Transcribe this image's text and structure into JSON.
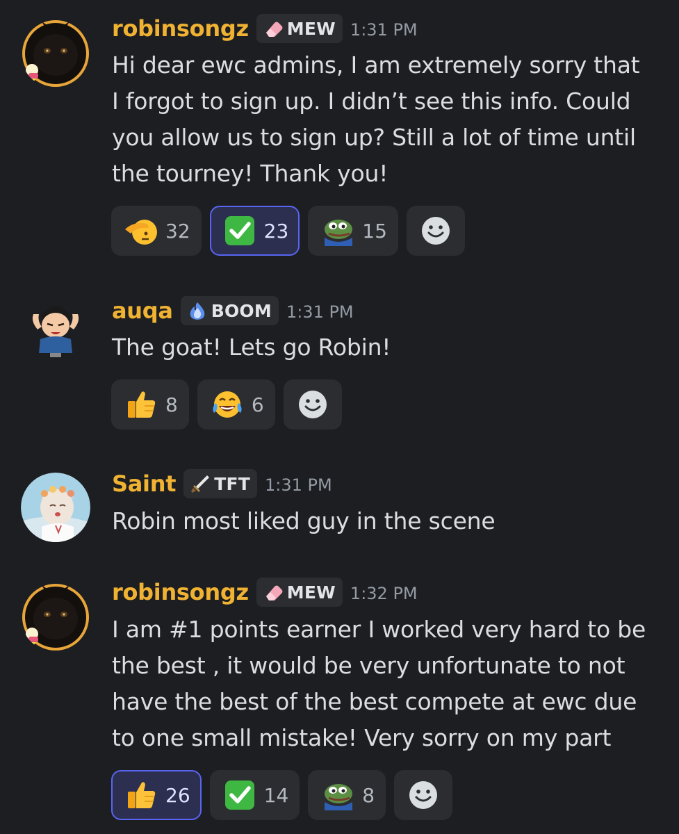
{
  "messages": [
    {
      "username": "robinsongz",
      "tag": "MEW",
      "time": "1:31 PM",
      "text": "Hi dear ewc admins, I am extremely sorry that\nI forgot to sign up. I didn’t see this info. Could\nyou allow us to sign up? Still a lot of time until\nthe tourney! Thank you!",
      "reactions": [
        {
          "emoji": "saluting-face",
          "count": "32"
        },
        {
          "emoji": "check-mark-button",
          "count": "23"
        },
        {
          "emoji": "pepe-frog",
          "count": "15"
        }
      ]
    },
    {
      "username": "auqa",
      "tag": "BOOM",
      "time": "1:31 PM",
      "text": "The goat! Lets go Robin!",
      "reactions": [
        {
          "emoji": "thumbs-up",
          "count": "8"
        },
        {
          "emoji": "tears-of-joy",
          "count": "6"
        }
      ]
    },
    {
      "username": "Saint",
      "tag": "TFT",
      "time": "1:31 PM",
      "text": "Robin most liked guy in the scene"
    },
    {
      "username": "robinsongz",
      "tag": "MEW",
      "time": "1:32 PM",
      "text": "I am #1 points earner I worked very hard to be\nthe best , it would be very unfortunate to not\nhave the best of the best compete at ewc due\nto one small mistake! Very sorry on my part",
      "reactions": [
        {
          "emoji": "thumbs-up",
          "count": "26"
        },
        {
          "emoji": "check-mark-button",
          "count": "14"
        },
        {
          "emoji": "pepe-frog",
          "count": "8"
        }
      ]
    }
  ],
  "colors": {
    "background": "#1d1e22",
    "username": "#f0b232",
    "active_reaction_border": "#5865f2"
  }
}
